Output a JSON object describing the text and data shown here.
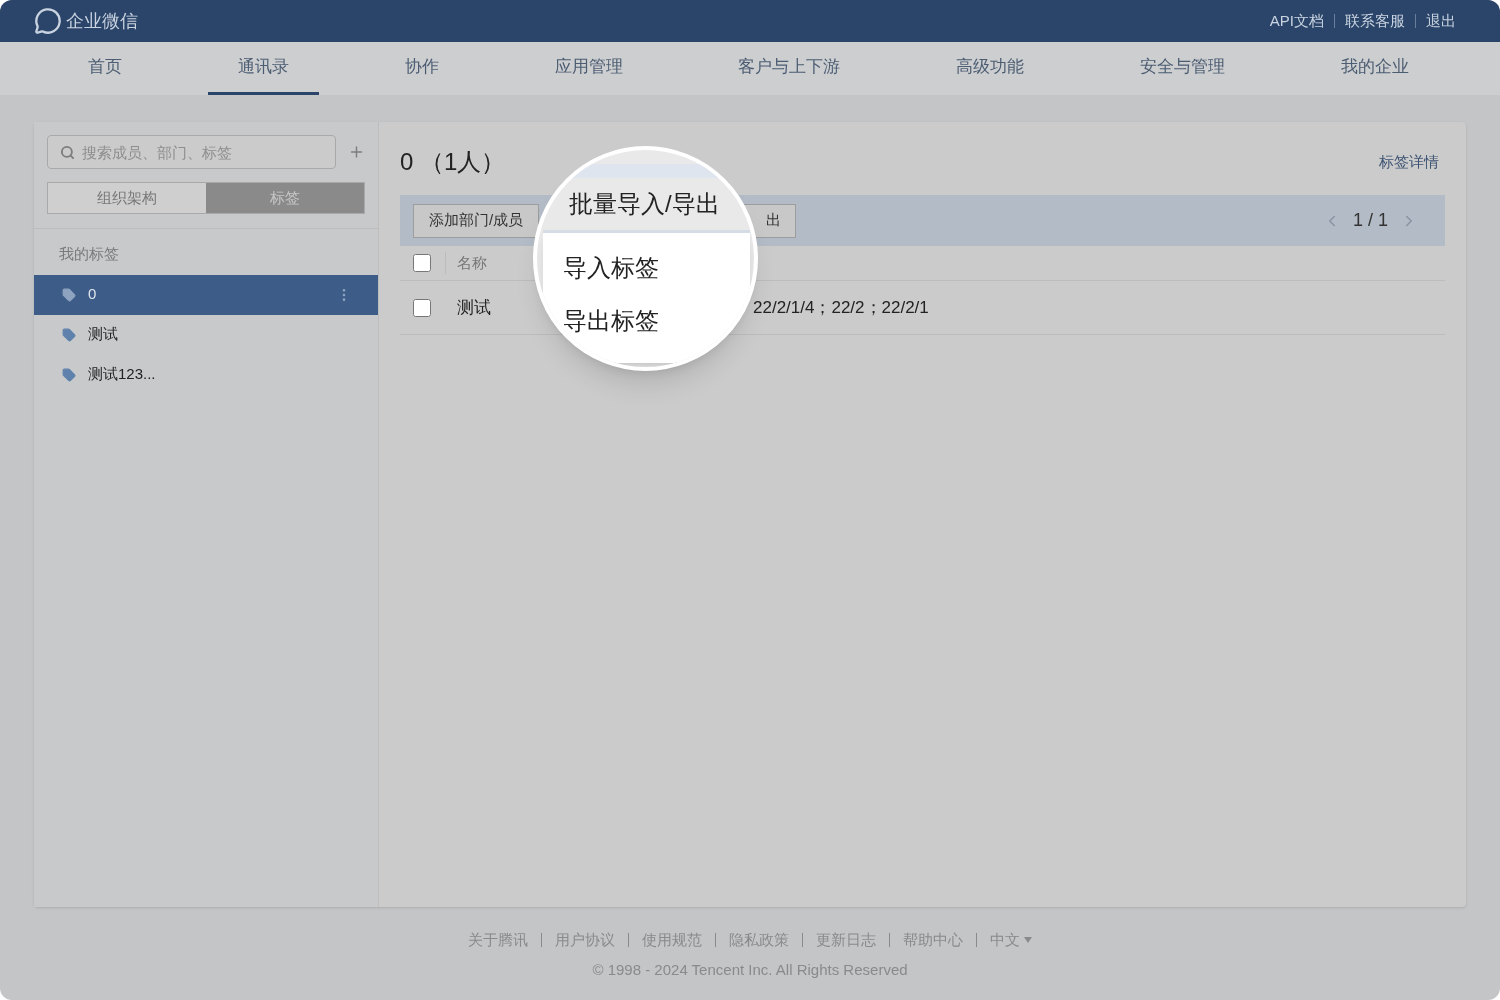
{
  "header": {
    "logo_text": "企业微信",
    "links": [
      {
        "label": "API文档"
      },
      {
        "label": "联系客服"
      },
      {
        "label": "退出"
      }
    ]
  },
  "nav": [
    {
      "label": "首页",
      "selected": false
    },
    {
      "label": "通讯录",
      "selected": true
    },
    {
      "label": "协作",
      "selected": false
    },
    {
      "label": "应用管理",
      "selected": false
    },
    {
      "label": "客户与上下游",
      "selected": false
    },
    {
      "label": "高级功能",
      "selected": false
    },
    {
      "label": "安全与管理",
      "selected": false
    },
    {
      "label": "我的企业",
      "selected": false
    }
  ],
  "sidebar": {
    "search": {
      "placeholder": "搜索成员、部门、标签"
    },
    "view_tabs": [
      {
        "label": "组织架构",
        "selected": false
      },
      {
        "label": "标签",
        "selected": true
      }
    ],
    "section_label": "我的标签",
    "tags": [
      {
        "label": "0",
        "selected": true
      },
      {
        "label": "测试",
        "selected": false
      },
      {
        "label": "测试123...",
        "selected": false
      }
    ]
  },
  "main": {
    "title": "0 （1人）",
    "detail_link": "标签详情",
    "toolbar_buttons": [
      "添加部门/成员",
      "出"
    ],
    "pager": "1 / 1",
    "table": {
      "header_checked": false,
      "columns": [
        "名称"
      ],
      "rows": [
        {
          "checked": false,
          "cells": [
            "测试",
            "22/2/1/4；22/2；22/2/1"
          ]
        }
      ]
    }
  },
  "magnifier": {
    "button_label": "批量导入/导出",
    "menu_items": [
      "导入标签",
      "导出标签"
    ]
  },
  "footer": {
    "links": [
      "关于腾讯",
      "用户协议",
      "使用规范",
      "隐私政策",
      "更新日志",
      "帮助中心"
    ],
    "language": "中文",
    "copyright": "© 1998 - 2024 Tencent Inc. All Rights Reserved"
  }
}
